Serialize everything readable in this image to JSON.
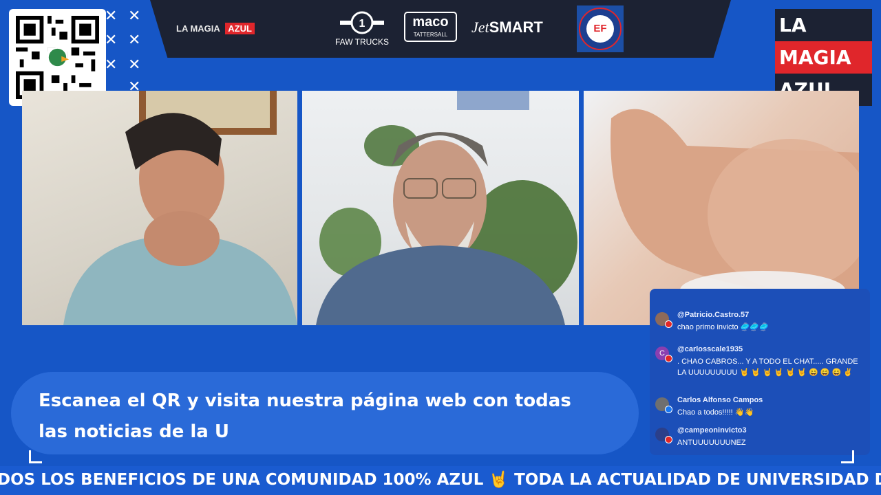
{
  "sponsors": {
    "left_logo_a": "LA MAGIA",
    "left_logo_b": "AZUL",
    "faw": "FAW TRUCKS",
    "maco": "maco",
    "maco_sub": "TATTERSALL",
    "jetsmart_a": "Jet",
    "jetsmart_b": "SMART",
    "school_badge": "EF"
  },
  "brand": {
    "line1": "LA",
    "line2": "MAGIA",
    "line3": "AZUL"
  },
  "banner": {
    "text": "Escanea el QR y visita nuestra página web con todas las noticias de la U"
  },
  "chat": {
    "messages": [
      {
        "author": "@Patricio.Castro.57",
        "text": "chao primo invicto 🥏🥏🥏",
        "avatar_color": "#8e6a5a",
        "source": "youtube"
      },
      {
        "author": "@carlosscale1935",
        "text": ". CHAO CABROS... Y A TODO EL CHAT..... GRANDE LA UUUUUUUUU 🤘 🤘 🤘 🤘 🤘 🤘 😄 😄 😄 ✌",
        "avatar_color": "#8a3fb0",
        "avatar_letter": "C",
        "source": "youtube"
      },
      {
        "author": "Carlos Alfonso Campos",
        "text": "Chao a todos!!!!! 👋👋",
        "avatar_color": "#6f6f6f",
        "source": "facebook"
      },
      {
        "author": "@campeoninvicto3",
        "text": "ANTUUUUUUUNEZ",
        "avatar_color": "#2b3f8a",
        "source": "youtube"
      }
    ]
  },
  "ticker": {
    "text": "DOS LOS BENEFICIOS DE UNA COMUNIDAD 100% AZUL 🤘 TODA LA ACTUALIDAD DE UNIVERSIDAD DE CHILE"
  },
  "colors": {
    "background": "#1656c6",
    "sponsor_bar": "#1c2233",
    "brand_red": "#e0262b",
    "brand_dark": "#1c2233"
  },
  "icons": [
    "qr-code-icon",
    "faw-logo-icon",
    "school-badge-icon",
    "youtube-source-icon",
    "facebook-source-icon"
  ]
}
